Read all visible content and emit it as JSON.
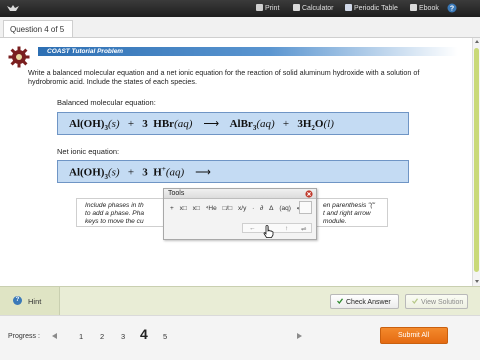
{
  "toolbar": {
    "print": "Print",
    "calculator": "Calculator",
    "periodic_table": "Periodic Table",
    "ebook": "Ebook"
  },
  "question": {
    "tab": "Question 4 of 5"
  },
  "tutorial": {
    "banner": "COAST Tutorial Problem",
    "prompt": "Write a balanced molecular equation and a net ionic equation for the reaction of solid aluminum hydroxide with a solution of hydrobromic acid. Include the states of each species."
  },
  "balanced": {
    "label": "Balanced molecular equation:",
    "reactant1": "Al(OH)",
    "reactant1_sub": "3",
    "reactant1_state": "(s)",
    "plus": "+",
    "coef2": "3",
    "reactant2": "HBr",
    "reactant2_state": "(aq)",
    "arrow": "⟶",
    "product1": "AlBr",
    "product1_sub": "3",
    "product1_state": "(aq)",
    "coef3": "3",
    "product2": "H",
    "product2_sub": "2",
    "product2_rest": "O",
    "product2_state": "(l)"
  },
  "net": {
    "label": "Net ionic equation:",
    "reactant1": "Al(OH)",
    "reactant1_sub": "3",
    "reactant1_state": "(s)",
    "plus": "+",
    "coef2": "3",
    "reactant2": "H",
    "reactant2_sup": "+",
    "reactant2_state": "(aq)",
    "arrow": "⟶"
  },
  "hint_text": {
    "line1_left": "Include phases in th",
    "line1_right": "en parenthesis \"(\"",
    "line2_left": "to add a phase. Pha",
    "line2_right": "t and right arrow",
    "line3_left": "keys to move the cu",
    "line3_right": "module."
  },
  "tools": {
    "title": "Tools",
    "row1": [
      "+",
      "x□",
      "x□",
      "⁴He",
      "□/□",
      "x/y",
      "·",
      "∂",
      "Δ",
      "(aq)",
      "⇌"
    ],
    "row2": [
      "←",
      "↓",
      "↑",
      "⇌"
    ]
  },
  "bottom": {
    "hint": "Hint",
    "check_answer": "Check Answer",
    "view_solution": "View Solution"
  },
  "progress": {
    "label": "Progress :",
    "pages": [
      "1",
      "2",
      "3",
      "4",
      "5"
    ],
    "current": "4",
    "submit": "Submit All"
  },
  "colors": {
    "topbar": "#2a2a2a",
    "equation_box": "#c4dbf3",
    "banner": "#2d6fb3",
    "submit": "#ef7d22",
    "bottombar": "#e9edd6"
  }
}
